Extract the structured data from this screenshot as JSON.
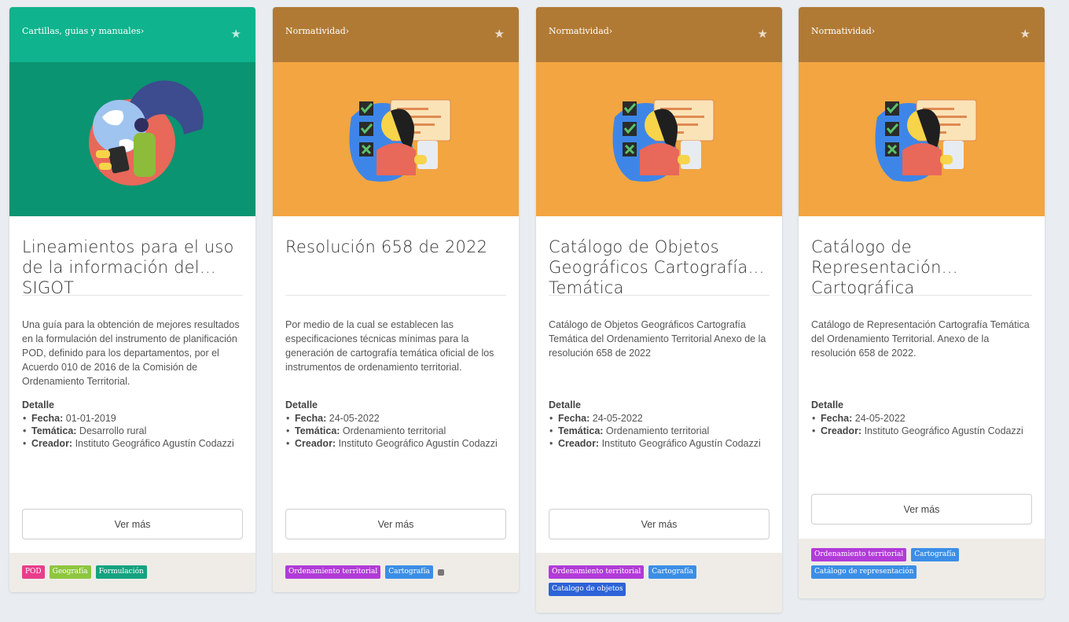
{
  "colors": {
    "teal_header": "#0fb38d",
    "teal_image": "#0a9471",
    "brown_header": "#b07a35",
    "orange_image": "#f2a541",
    "tag_pink": "#e83e8c",
    "tag_green": "#8dc63f",
    "tag_teal": "#14a37f",
    "tag_purple": "#b13bd8",
    "tag_blue": "#3b8ee6",
    "tag_darkblue": "#2d63d8"
  },
  "cards": [
    {
      "category": "Cartillas, guias y manuales›",
      "title": "Lineamientos para el uso de la información del SIGOT",
      "description": "Una guía para la obtención de mejores resultados en la formulación del instrumento de planificación POD, definido para los departamentos, por el Acuerdo 010 de 2016 de la Comisión de Ordenamiento Territorial.",
      "detail_label": "Detalle",
      "details": [
        {
          "key": "Fecha:",
          "value": "01-01-2019"
        },
        {
          "key": "Temática:",
          "value": "Desarrollo rural"
        },
        {
          "key": "Creador:",
          "value": "Instituto Geográfico Agustín Codazzi"
        }
      ],
      "button_label": "Ver más",
      "tags": [
        {
          "label": "POD",
          "color": "#e83e8c"
        },
        {
          "label": "Geografía",
          "color": "#8dc63f"
        },
        {
          "label": "Formulación",
          "color": "#14a37f"
        }
      ]
    },
    {
      "category": "Normatividad›",
      "title": "Resolución 658 de 2022",
      "description": "Por medio de la cual se establecen las especificaciones técnicas mínimas para la generación de cartografía temática oficial de los instrumentos de ordenamiento territorial.",
      "detail_label": "Detalle",
      "details": [
        {
          "key": "Fecha:",
          "value": "24-05-2022"
        },
        {
          "key": "Temática:",
          "value": "Ordenamiento territorial"
        },
        {
          "key": "Creador:",
          "value": "Instituto Geográfico Agustín Codazzi"
        }
      ],
      "button_label": "Ver más",
      "tags": [
        {
          "label": "Ordenamiento territorial",
          "color": "#b13bd8"
        },
        {
          "label": "Cartografía",
          "color": "#3b8ee6"
        }
      ]
    },
    {
      "category": "Normatividad›",
      "title": "Catálogo de Objetos Geográficos Cartografía Temática",
      "description": "Catálogo de Objetos Geográficos Cartografía Temática del Ordenamiento Territorial Anexo de la resolución 658 de 2022",
      "detail_label": "Detalle",
      "details": [
        {
          "key": "Fecha:",
          "value": "24-05-2022"
        },
        {
          "key": "Temática:",
          "value": "Ordenamiento territorial"
        },
        {
          "key": "Creador:",
          "value": "Instituto Geográfico Agustín Codazzi"
        }
      ],
      "button_label": "Ver más",
      "tags": [
        {
          "label": "Ordenamiento territorial",
          "color": "#b13bd8"
        },
        {
          "label": "Cartografía",
          "color": "#3b8ee6"
        },
        {
          "label": "Catalogo de objetos",
          "color": "#2d63d8"
        }
      ]
    },
    {
      "category": "Normatividad›",
      "title": "Catálogo de Representación Cartográfica",
      "description": "Catálogo de Representación Cartografía Temática del Ordenamiento Territorial. Anexo de la resolución 658 de 2022.",
      "detail_label": "Detalle",
      "details": [
        {
          "key": "Fecha:",
          "value": "24-05-2022"
        },
        {
          "key": "Creador:",
          "value": "Instituto Geográfico Agustín Codazzi"
        }
      ],
      "button_label": "Ver más",
      "tags": [
        {
          "label": "Ordenamiento territorial",
          "color": "#b13bd8"
        },
        {
          "label": "Cartografía",
          "color": "#3b8ee6"
        },
        {
          "label": "Catálogo de representación",
          "color": "#3b8ee6"
        }
      ]
    }
  ]
}
